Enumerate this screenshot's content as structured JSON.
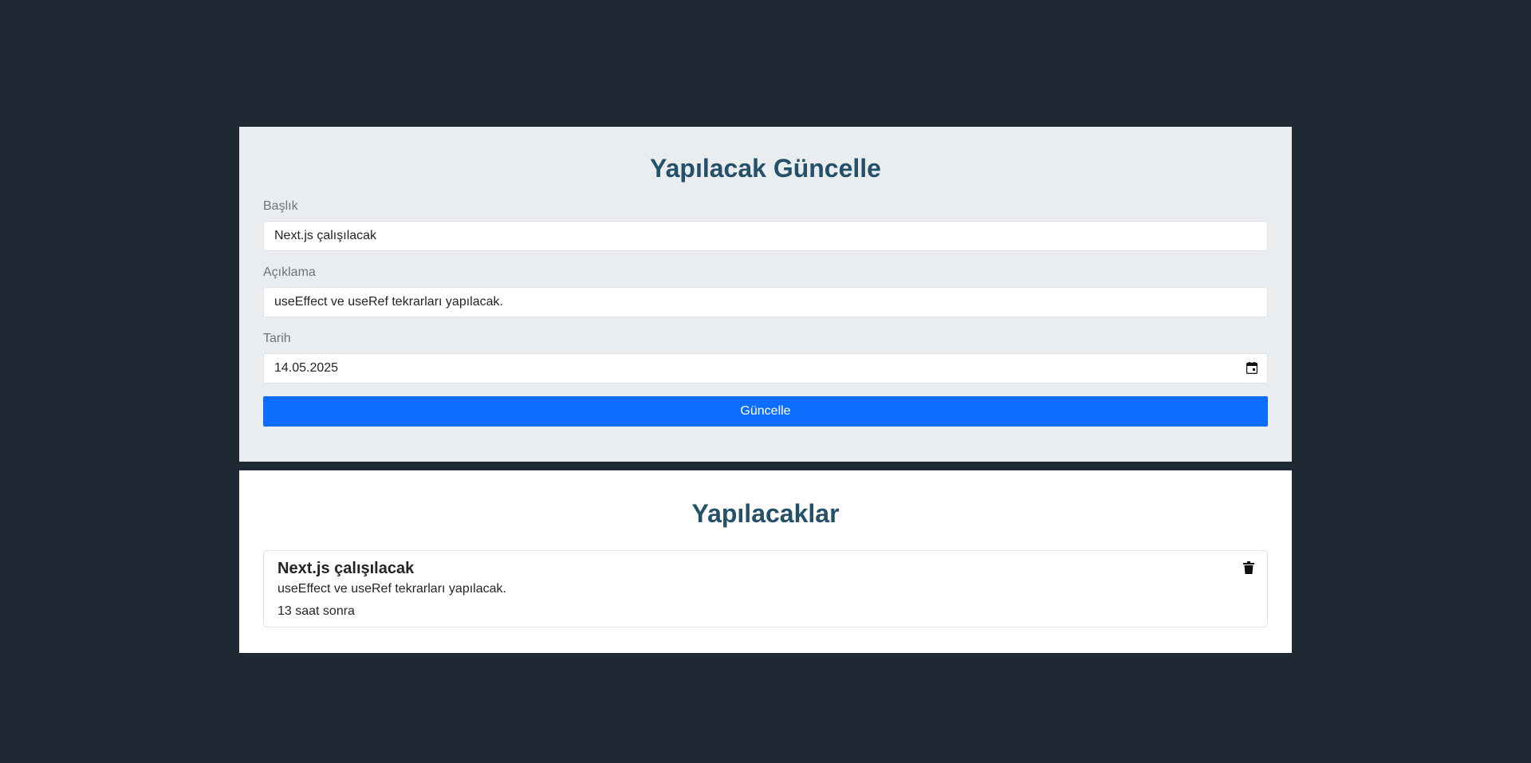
{
  "update_form": {
    "heading": "Yapılacak Güncelle",
    "title_label": "Başlık",
    "title_value": "Next.js çalışılacak",
    "description_label": "Açıklama",
    "description_value": "useEffect ve useRef tekrarları yapılacak.",
    "date_label": "Tarih",
    "date_value": "14.05.2025",
    "submit_label": "Güncelle",
    "icons": {
      "date": "calendar-icon"
    }
  },
  "todo_list": {
    "heading": "Yapılacaklar",
    "items": [
      {
        "title": "Next.js çalışılacak",
        "description": "useEffect ve useRef tekrarları yapılacak.",
        "relative_time": "13 saat sonra",
        "delete_icon": "trash-icon"
      }
    ]
  },
  "colors": {
    "page_background": "#1f2933",
    "form_background": "#e9edef",
    "heading": "#24506a",
    "primary_button": "#0d6efd"
  }
}
